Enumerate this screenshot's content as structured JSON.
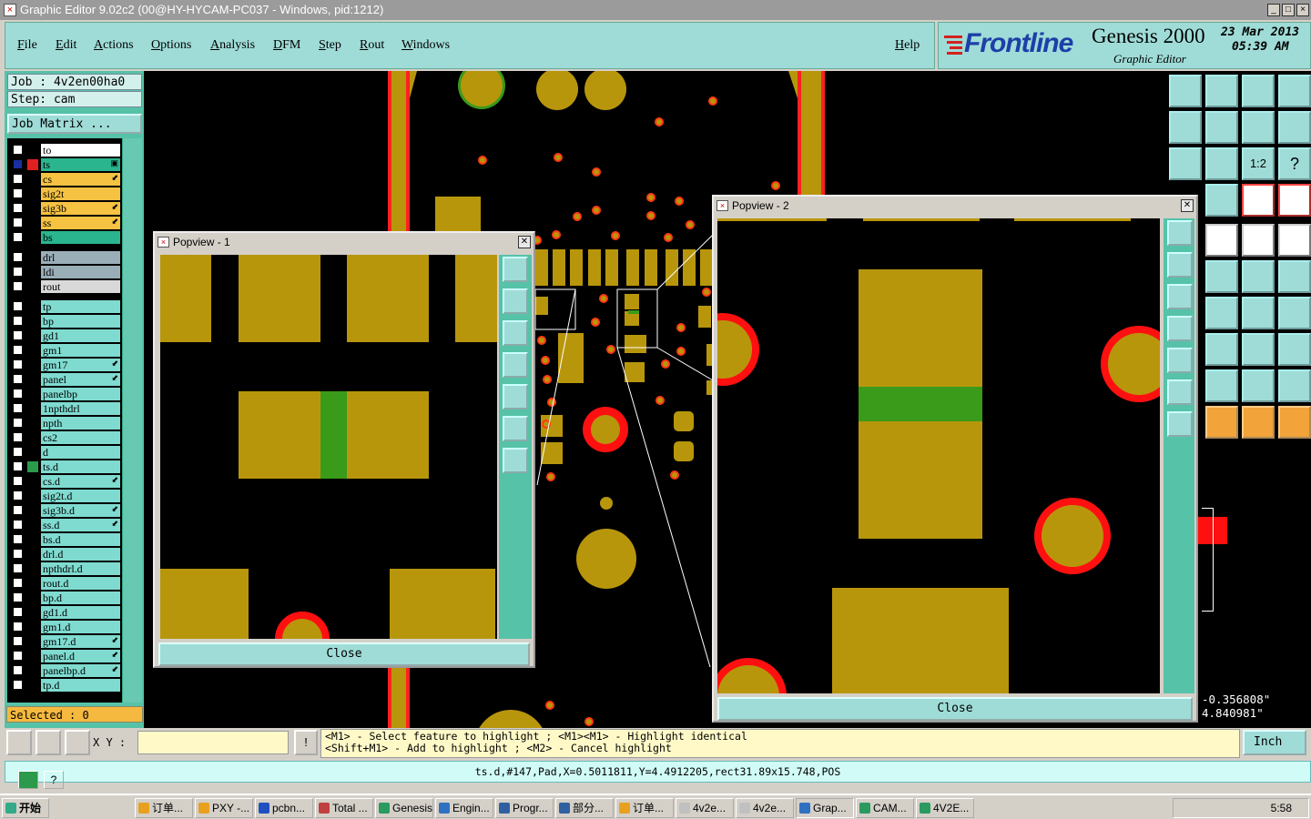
{
  "window": {
    "title": "Graphic Editor 9.02c2 (00@HY-HYCAM-PC037 - Windows, pid:1212)",
    "buttons": [
      "_",
      "□",
      "×"
    ]
  },
  "menu": {
    "items": [
      "File",
      "Edit",
      "Actions",
      "Options",
      "Analysis",
      "DFM",
      "Step",
      "Rout",
      "Windows"
    ],
    "help": "Help"
  },
  "brand": {
    "logo": "Frontline",
    "product": "Genesis 2000",
    "subtitle": "Graphic Editor",
    "date": "23 Mar 2013",
    "time": "05:39 AM"
  },
  "job": {
    "job_line": "Job : 4v2en00ha0",
    "step_line": "Step: cam",
    "matrix_button": "Job Matrix ..."
  },
  "layers": [
    {
      "name": "to",
      "color": "#ffffff",
      "mark": ""
    },
    {
      "name": "ts",
      "color": "#2ab58e",
      "mark": "▣",
      "active": true
    },
    {
      "name": "cs",
      "color": "#f5c242",
      "mark": "⬋"
    },
    {
      "name": "sig2t",
      "color": "#f5c242",
      "mark": ""
    },
    {
      "name": "sig3b",
      "color": "#f5c242",
      "mark": "⬋"
    },
    {
      "name": "ss",
      "color": "#f5c242",
      "mark": "⬋"
    },
    {
      "name": "bs",
      "color": "#2ab58e",
      "mark": ""
    },
    {
      "name": "drl",
      "color": "#9aaeb8",
      "mark": ""
    },
    {
      "name": "ldi",
      "color": "#9aaeb8",
      "mark": ""
    },
    {
      "name": "rout",
      "color": "#d9d9d9",
      "mark": ""
    },
    {
      "name": "tp",
      "color": "#7fdbd0",
      "mark": ""
    },
    {
      "name": "bp",
      "color": "#7fdbd0",
      "mark": ""
    },
    {
      "name": "gd1",
      "color": "#7fdbd0",
      "mark": ""
    },
    {
      "name": "gm1",
      "color": "#7fdbd0",
      "mark": ""
    },
    {
      "name": "gm17",
      "color": "#7fdbd0",
      "mark": "⬋"
    },
    {
      "name": "panel",
      "color": "#7fdbd0",
      "mark": "⬋"
    },
    {
      "name": "panelbp",
      "color": "#7fdbd0",
      "mark": ""
    },
    {
      "name": "1npthdrl",
      "color": "#7fdbd0",
      "mark": ""
    },
    {
      "name": "npth",
      "color": "#7fdbd0",
      "mark": ""
    },
    {
      "name": "cs2",
      "color": "#7fdbd0",
      "mark": ""
    },
    {
      "name": "d",
      "color": "#7fdbd0",
      "mark": ""
    },
    {
      "name": "ts.d",
      "color": "#7fdbd0",
      "mark": "",
      "dot": true
    },
    {
      "name": "cs.d",
      "color": "#7fdbd0",
      "mark": "⬋"
    },
    {
      "name": "sig2t.d",
      "color": "#7fdbd0",
      "mark": ""
    },
    {
      "name": "sig3b.d",
      "color": "#7fdbd0",
      "mark": "⬋"
    },
    {
      "name": "ss.d",
      "color": "#7fdbd0",
      "mark": "⬋"
    },
    {
      "name": "bs.d",
      "color": "#7fdbd0",
      "mark": ""
    },
    {
      "name": "drl.d",
      "color": "#7fdbd0",
      "mark": ""
    },
    {
      "name": "npthdrl.d",
      "color": "#7fdbd0",
      "mark": ""
    },
    {
      "name": "rout.d",
      "color": "#7fdbd0",
      "mark": ""
    },
    {
      "name": "bp.d",
      "color": "#7fdbd0",
      "mark": ""
    },
    {
      "name": "gd1.d",
      "color": "#7fdbd0",
      "mark": ""
    },
    {
      "name": "gm1.d",
      "color": "#7fdbd0",
      "mark": ""
    },
    {
      "name": "gm17.d",
      "color": "#7fdbd0",
      "mark": "⬋"
    },
    {
      "name": "panel.d",
      "color": "#7fdbd0",
      "mark": "⬋"
    },
    {
      "name": "panelbp.d",
      "color": "#7fdbd0",
      "mark": "⬋"
    },
    {
      "name": "tp.d",
      "color": "#7fdbd0",
      "mark": ""
    }
  ],
  "selected": "Selected : 0",
  "popview1": {
    "title": "Popview - 1",
    "close": "Close"
  },
  "popview2": {
    "title": "Popview - 2",
    "close": "Close"
  },
  "coords": {
    "x": "-0.356808\"",
    "y": "4.840981\""
  },
  "command": {
    "xy_label": "X Y :",
    "xy_value": "",
    "hint_line1": "<M1> - Select feature to highlight ; <M1><M1> - Highlight identical",
    "hint_line2": "<Shift+M1> - Add to highlight ; <M2> - Cancel highlight",
    "units": "Inch"
  },
  "status": "ts.d,#147,Pad,X=0.5011811,Y=4.4912205,rect31.89x15.748,POS",
  "colors": {
    "copper": "#b8960c",
    "highlight_ring": "#ff1010",
    "selected_green": "#3a9a1a",
    "panel_teal": "#56c2a8"
  },
  "taskbar": {
    "start": "开始",
    "tasks": [
      "订单...",
      "PXY -...",
      "pcbn...",
      "Total ...",
      "Genesis",
      "Engin...",
      "Progr...",
      "部分...",
      "订单...",
      "4v2e...",
      "4v2e...",
      "Grap...",
      "CAM...",
      "4V2E..."
    ],
    "clock": "5:58"
  }
}
